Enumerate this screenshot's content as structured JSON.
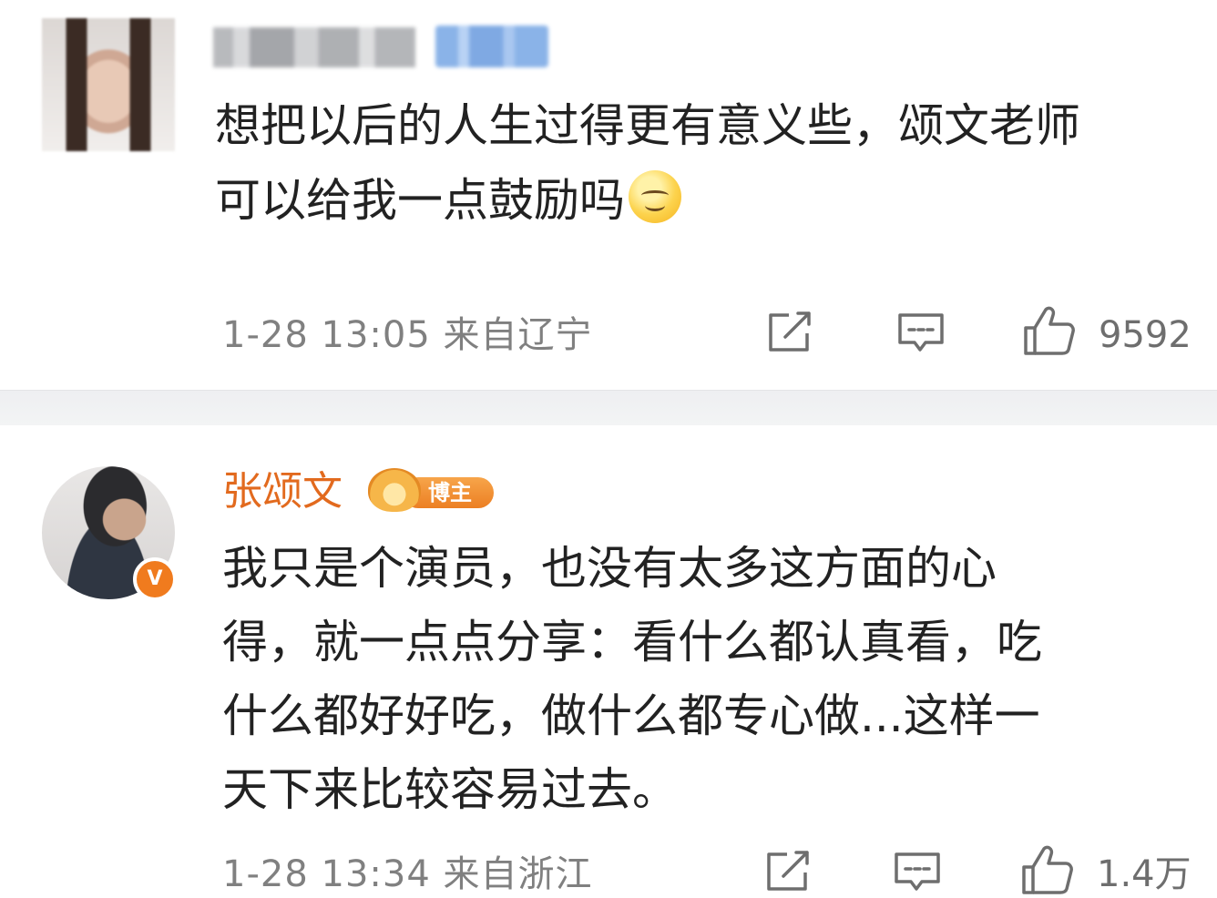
{
  "comments": [
    {
      "username_display": "",
      "text_line1": "想把以后的人生过得更有意义些，颂文老师",
      "text_line2": "可以给我一点鼓励吗",
      "emoji": "smile-emoji",
      "date": "1-28",
      "time": "13:05",
      "location": "来自辽宁",
      "like_count": "9592"
    },
    {
      "username": "张颂文",
      "badge_label": "博主",
      "verified_mark": "V",
      "text_lines": [
        "我只是个演员，也没有太多这方面的心",
        "得，就一点点分享：看什么都认真看，吃",
        "什么都好好吃，做什么都专心做...这样一",
        "天下来比较容易过去。"
      ],
      "date": "1-28",
      "time": "13:34",
      "location": "来自浙江",
      "like_count": "1.4万"
    }
  ],
  "icons": {
    "share": "share-icon",
    "reply": "comment-icon",
    "like": "thumbs-up-icon"
  },
  "colors": {
    "username_orange": "#e26a1e",
    "text": "#222222",
    "meta_gray": "#808080",
    "verified_orange": "#f07b1e"
  }
}
